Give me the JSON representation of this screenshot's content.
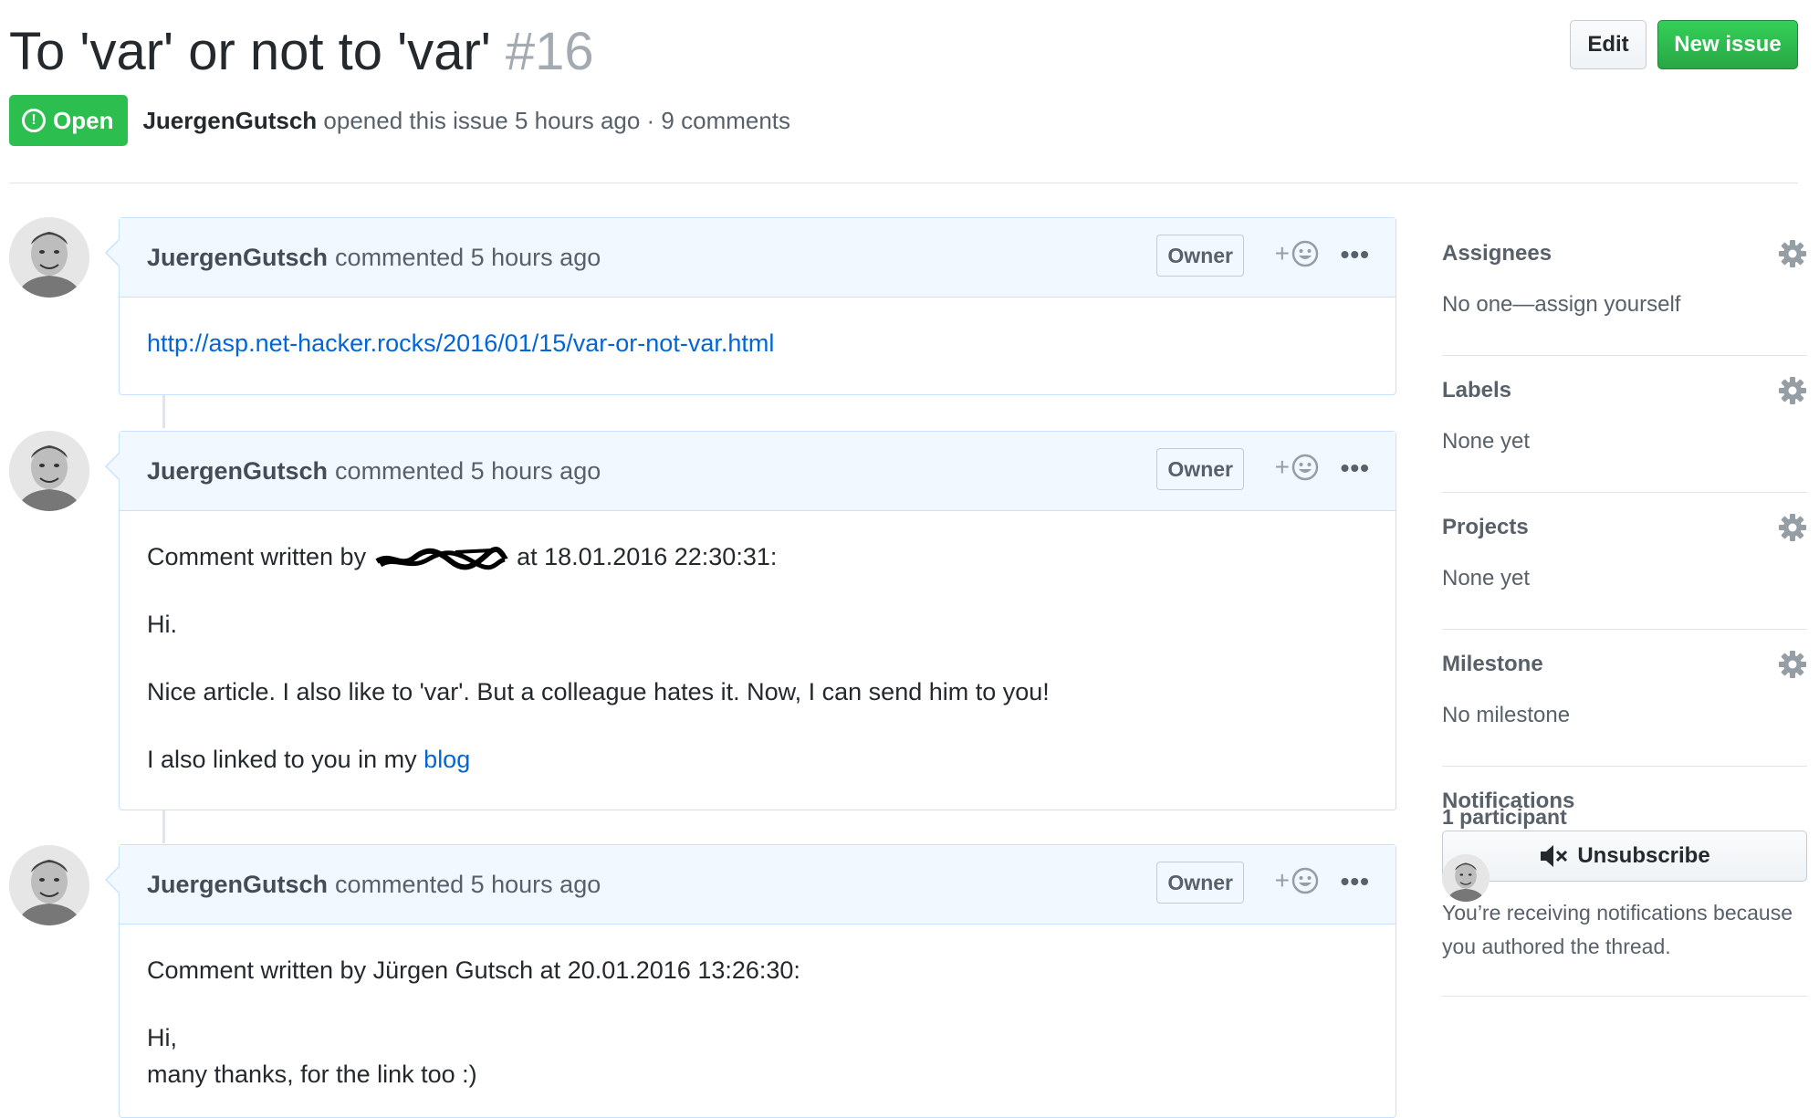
{
  "issue": {
    "title": "To 'var' or not to 'var'",
    "number": "#16",
    "state": "Open",
    "author": "JuergenGutsch",
    "meta": "opened this issue 5 hours ago · 9 comments",
    "edit_label": "Edit",
    "new_issue_label": "New issue"
  },
  "comments": [
    {
      "author": "JuergenGutsch",
      "meta": "commented 5 hours ago",
      "badge": "Owner",
      "body": {
        "link": "http://asp.net-hacker.rocks/2016/01/15/var-or-not-var.html"
      }
    },
    {
      "author": "JuergenGutsch",
      "meta": "commented 5 hours ago",
      "badge": "Owner",
      "body": {
        "line1_prefix": "Comment written by",
        "line1_suffix": "at 18.01.2016 22:30:31:",
        "line2": "Hi.",
        "line3": "Nice article. I also like to 'var'. But a colleague hates it. Now, I can send him to you!",
        "line4_prefix": "I also linked to you in my",
        "line4_link": "blog"
      }
    },
    {
      "author": "JuergenGutsch",
      "meta": "commented 5 hours ago",
      "badge": "Owner",
      "body": {
        "line1": "Comment written by Jürgen Gutsch at 20.01.2016 13:26:30:",
        "line2": "Hi,",
        "line3": "many thanks, for the link too :)"
      }
    }
  ],
  "sidebar": {
    "assignees": {
      "title": "Assignees",
      "value": "No one—assign yourself"
    },
    "labels": {
      "title": "Labels",
      "value": "None yet"
    },
    "projects": {
      "title": "Projects",
      "value": "None yet"
    },
    "milestone": {
      "title": "Milestone",
      "value": "No milestone"
    },
    "notifications": {
      "title": "Notifications",
      "button": "Unsubscribe",
      "reason": "You’re receiving notifications because you authored the thread."
    },
    "participants": {
      "title": "1 participant"
    }
  },
  "colors": {
    "open_green": "#2cbe4e",
    "new_issue_green": "#28a745",
    "link_blue": "#0366d6",
    "comment_header_bg": "#f1f8ff",
    "comment_border": "#c8e1ff"
  }
}
